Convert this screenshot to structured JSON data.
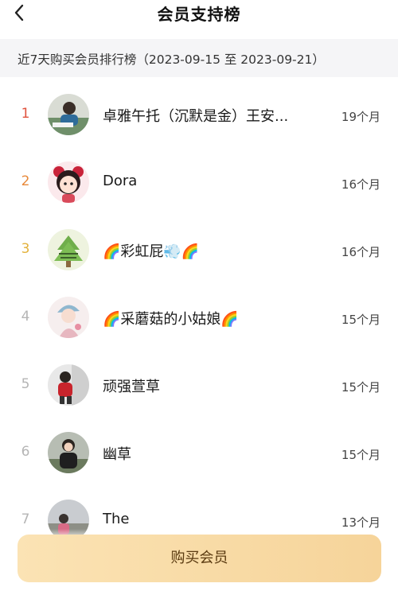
{
  "header": {
    "title": "会员支持榜",
    "back_icon": "chevron-left-icon"
  },
  "date_range": "近7天购买会员排行榜（2023-09-15 至 2023-09-21）",
  "colors": {
    "rank1": "#e0533e",
    "rank2": "#e8893a",
    "rank3": "#e3b23c",
    "rank_other": "#b5b5b5"
  },
  "rows": [
    {
      "rank": "1",
      "name": "卓雅午托（沉默是金）王安...",
      "months": "19个月"
    },
    {
      "rank": "2",
      "name": "Dora",
      "months": "16个月"
    },
    {
      "rank": "3",
      "name": "🌈彩虹屁💨🌈",
      "months": "16个月"
    },
    {
      "rank": "4",
      "name": "🌈采蘑菇的小姑娘🌈",
      "months": "15个月"
    },
    {
      "rank": "5",
      "name": "顽强萱草",
      "months": "15个月"
    },
    {
      "rank": "6",
      "name": "幽草",
      "months": "15个月"
    },
    {
      "rank": "7",
      "name": "The",
      "months": "13个月"
    }
  ],
  "buy_button": {
    "label": "购买会员"
  }
}
